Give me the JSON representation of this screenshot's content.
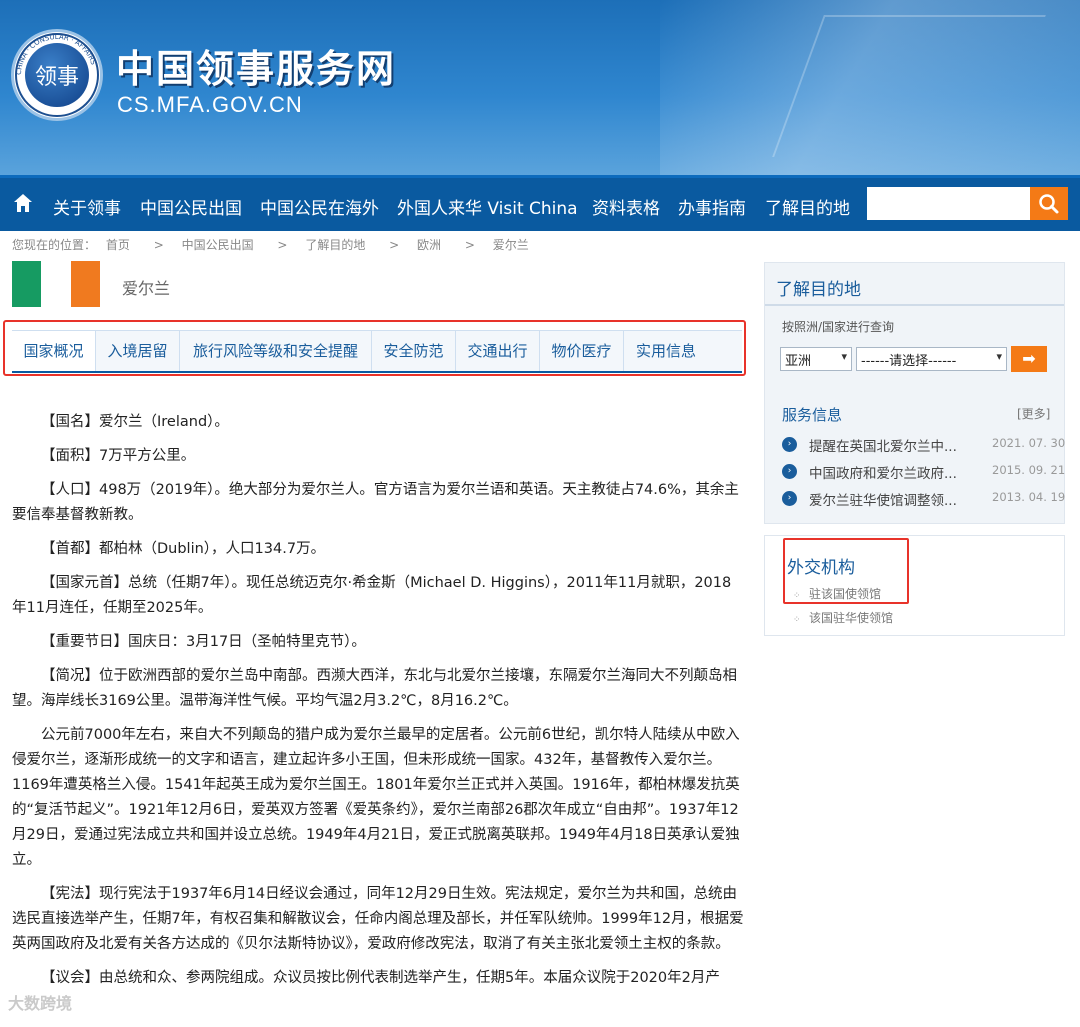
{
  "site": {
    "title": "中国领事服务网",
    "domain": "CS.MFA.GOV.CN",
    "logo_text": "领事",
    "logo_ring_text": "CHINA · CONSULAR · AFFAIRS"
  },
  "nav": {
    "items": [
      "关于领事",
      "中国公民出国",
      "中国公民在海外",
      "外国人来华 Visit China",
      "资料表格",
      "办事指南",
      "了解目的地"
    ],
    "search_placeholder": ""
  },
  "breadcrumb": [
    "您现在的位置：",
    "首页",
    ">",
    "中国公民出国",
    ">",
    "了解目的地",
    ">",
    "欧洲",
    ">",
    "爱尔兰"
  ],
  "country": {
    "name": "爱尔兰",
    "flag_colors": [
      "#169b62",
      "#ffffff",
      "#f07a1f"
    ]
  },
  "tabs": [
    "国家概况",
    "入境居留",
    "旅行风险等级和安全提醒",
    "安全防范",
    "交通出行",
    "物价医疗",
    "实用信息"
  ],
  "content": [
    "【国名】爱尔兰（Ireland）。",
    "【面积】7万平方公里。",
    "【人口】498万（2019年）。绝大部分为爱尔兰人。官方语言为爱尔兰语和英语。天主教徒占74.6%，其余主要信奉基督教新教。",
    "【首都】都柏林（Dublin），人口134.7万。",
    "【国家元首】总统（任期7年）。现任总统迈克尔·希金斯（Michael D. Higgins），2011年11月就职，2018年11月连任，任期至2025年。",
    "【重要节日】国庆日：3月17日（圣帕特里克节）。",
    "【简况】位于欧洲西部的爱尔兰岛中南部。西濒大西洋，东北与北爱尔兰接壤，东隔爱尔兰海同大不列颠岛相望。海岸线长3169公里。温带海洋性气候。平均气温2月3.2℃，8月16.2℃。",
    "公元前7000年左右，来自大不列颠岛的猎户成为爱尔兰最早的定居者。公元前6世纪，凯尔特人陆续从中欧入侵爱尔兰，逐渐形成统一的文字和语言，建立起许多小王国，但未形成统一国家。432年，基督教传入爱尔兰。1169年遭英格兰入侵。1541年起英王成为爱尔兰国王。1801年爱尔兰正式并入英国。1916年，都柏林爆发抗英的“复活节起义”。1921年12月6日，爱英双方签署《爱英条约》，爱尔兰南部26郡次年成立“自由邦”。1937年12月29日，爱通过宪法成立共和国并设立总统。1949年4月21日，爱正式脱离英联邦。1949年4月18日英承认爱独立。",
    "【宪法】现行宪法于1937年6月14日经议会通过，同年12月29日生效。宪法规定，爱尔兰为共和国，总统由选民直接选举产生，任期7年，有权召集和解散议会，任命内阁总理及部长，并任军队统帅。1999年12月，根据爱英两国政府及北爱有关各方达成的《贝尔法斯特协议》，爱政府修改宪法，取消了有关主张北爱领土主权的条款。",
    "【议会】由总统和众、参两院组成。众议员按比例代表制选举产生，任期5年。本届众议院于2020年2月产"
  ],
  "sidebar": {
    "destination": {
      "title": "了解目的地",
      "query_label": "按照洲/国家进行查询",
      "continent_select": "亚洲",
      "country_select": "------请选择------",
      "go_icon": "arrow-right-icon"
    },
    "service": {
      "title": "服务信息",
      "more": "[更多]",
      "items": [
        {
          "title": "提醒在英国北爱尔兰中...",
          "date": "2021. 07. 30"
        },
        {
          "title": "中国政府和爱尔兰政府...",
          "date": "2015. 09. 21"
        },
        {
          "title": "爱尔兰驻华使馆调整领...",
          "date": "2013. 04. 19"
        }
      ]
    },
    "diplomatic": {
      "title": "外交机构",
      "links": [
        "驻该国使领馆",
        "该国驻华使领馆"
      ]
    }
  },
  "watermark": "大数跨境",
  "colors": {
    "nav_bg": "#0a5aa0",
    "accent_orange": "#f47a16",
    "link_blue": "#1a5d9c",
    "highlight_red": "#e8332a"
  }
}
